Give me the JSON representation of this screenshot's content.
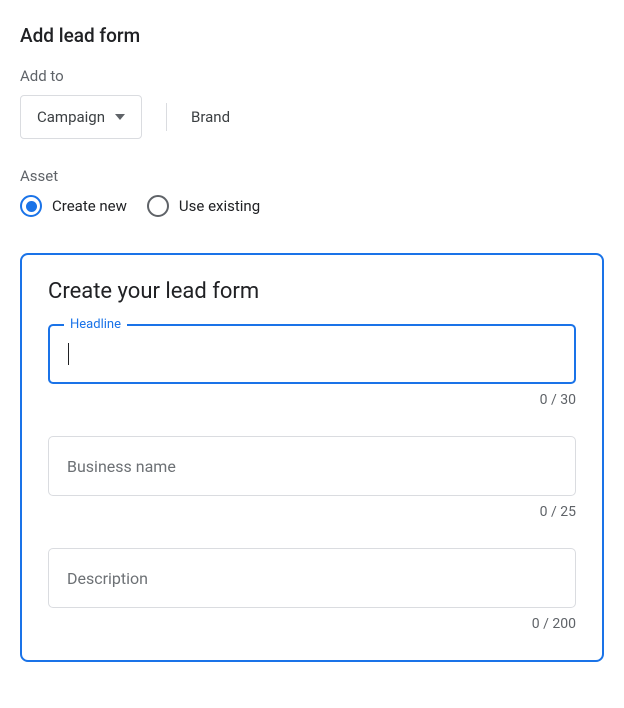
{
  "title": "Add lead form",
  "addto": {
    "label": "Add to",
    "dropdown": "Campaign",
    "context": "Brand"
  },
  "asset": {
    "label": "Asset",
    "options": {
      "create": "Create new",
      "existing": "Use existing"
    },
    "selected": "create"
  },
  "form": {
    "title": "Create your lead form",
    "headline": {
      "label": "Headline",
      "value": "",
      "counter": "0 / 30"
    },
    "business": {
      "placeholder": "Business name",
      "value": "",
      "counter": "0 / 25"
    },
    "description": {
      "placeholder": "Description",
      "value": "",
      "counter": "0 / 200"
    }
  }
}
